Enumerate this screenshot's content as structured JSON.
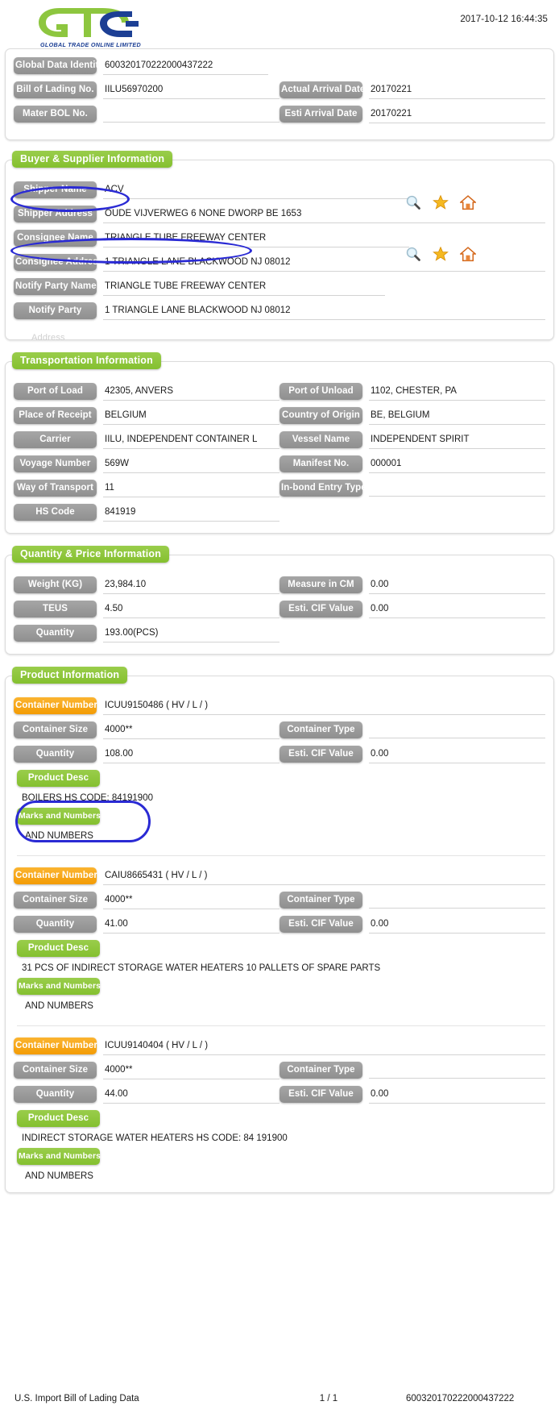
{
  "header": {
    "logo_text_main": "GTO",
    "logo_tagline": "GLOBAL TRADE  ONLINE LIMITED",
    "timestamp": "2017-10-12 16:44:35"
  },
  "identity": {
    "fields": [
      {
        "label": "Global Data Identity",
        "value": "600320170222000437222"
      },
      {
        "label": "Bill of Lading No.",
        "value": "IILU56970200"
      },
      {
        "label": "Actual Arrival Date",
        "value": "20170221"
      },
      {
        "label": "Mater BOL No.",
        "value": ""
      },
      {
        "label": "Esti Arrival Date",
        "value": "20170221"
      }
    ]
  },
  "buyer_supplier": {
    "title": "Buyer & Supplier Information",
    "ghost_text": "Address",
    "fields": [
      {
        "label": "Shipper Name",
        "value": "ACV"
      },
      {
        "label": "Shipper Address",
        "value": "OUDE VIJVERWEG 6 NONE DWORP BE 1653"
      },
      {
        "label": "Consignee Name",
        "value": "TRIANGLE TUBE FREEWAY CENTER"
      },
      {
        "label": "Consignee Address",
        "value": "1 TRIANGLE LANE BLACKWOOD NJ 08012"
      },
      {
        "label": "Notify Party Name",
        "value": "TRIANGLE TUBE FREEWAY CENTER"
      },
      {
        "label": "Notify Party",
        "value": "1 TRIANGLE LANE BLACKWOOD NJ 08012"
      }
    ],
    "icons": [
      "search-icon",
      "star-icon",
      "home-icon"
    ]
  },
  "transportation": {
    "title": "Transportation Information",
    "fields": [
      {
        "label": "Port of Load",
        "value": "42305, ANVERS"
      },
      {
        "label": "Port of Unload",
        "value": "1102, CHESTER, PA"
      },
      {
        "label": "Place of Receipt",
        "value": "BELGIUM"
      },
      {
        "label": "Country of Origin",
        "value": "BE, BELGIUM"
      },
      {
        "label": "Carrier",
        "value": "IILU, INDEPENDENT CONTAINER L"
      },
      {
        "label": "Vessel Name",
        "value": "INDEPENDENT SPIRIT"
      },
      {
        "label": "Voyage Number",
        "value": "569W"
      },
      {
        "label": "Manifest No.",
        "value": "000001"
      },
      {
        "label": "Way of Transport",
        "value": "11"
      },
      {
        "label": "In-bond Entry Type",
        "value": ""
      },
      {
        "label": "HS Code",
        "value": "841919"
      }
    ]
  },
  "quantity_price": {
    "title": "Quantity & Price Information",
    "fields": [
      {
        "label": "Weight (KG)",
        "value": "23,984.10"
      },
      {
        "label": "Measure in CM",
        "value": "0.00"
      },
      {
        "label": "TEUS",
        "value": "4.50"
      },
      {
        "label": "Esti. CIF Value",
        "value": "0.00"
      },
      {
        "label": "Quantity",
        "value": "193.00(PCS)"
      }
    ]
  },
  "product_information": {
    "title": "Product Information",
    "labels": {
      "container_number": "Container Number",
      "container_size": "Container Size",
      "container_type": "Container Type",
      "quantity": "Quantity",
      "esti_cif_value": "Esti. CIF Value",
      "product_desc": "Product Desc",
      "marks_and_numbers": "Marks and Numbers"
    },
    "containers": [
      {
        "container_number": "ICUU9150486 ( HV / L /  )",
        "container_size": "4000**",
        "container_type": "",
        "quantity": "108.00",
        "esti_cif_value": "0.00",
        "product_desc": "BOILERS HS CODE: 84191900",
        "marks_and_numbers": "AND NUMBERS"
      },
      {
        "container_number": "CAIU8665431 ( HV / L /  )",
        "container_size": "4000**",
        "container_type": "",
        "quantity": "41.00",
        "esti_cif_value": "0.00",
        "product_desc": "31 PCS OF INDIRECT STORAGE WATER HEATERS 10 PALLETS OF SPARE PARTS",
        "marks_and_numbers": "AND NUMBERS"
      },
      {
        "container_number": "ICUU9140404 ( HV / L /  )",
        "container_size": "4000**",
        "container_type": "",
        "quantity": "44.00",
        "esti_cif_value": "0.00",
        "product_desc": "INDIRECT STORAGE WATER HEATERS HS CODE: 84 191900",
        "marks_and_numbers": "AND NUMBERS"
      }
    ]
  },
  "footer": {
    "left": "U.S. Import Bill of Lading Data",
    "page": "1 / 1",
    "right": "600320170222000437222"
  },
  "colors": {
    "green": "#8dc63f",
    "orange": "#f7a312",
    "grey": "#9a9a9a",
    "annotation_blue": "#2a2ad4",
    "logo_green": "#8dc63f",
    "logo_blue": "#1c3f94"
  }
}
